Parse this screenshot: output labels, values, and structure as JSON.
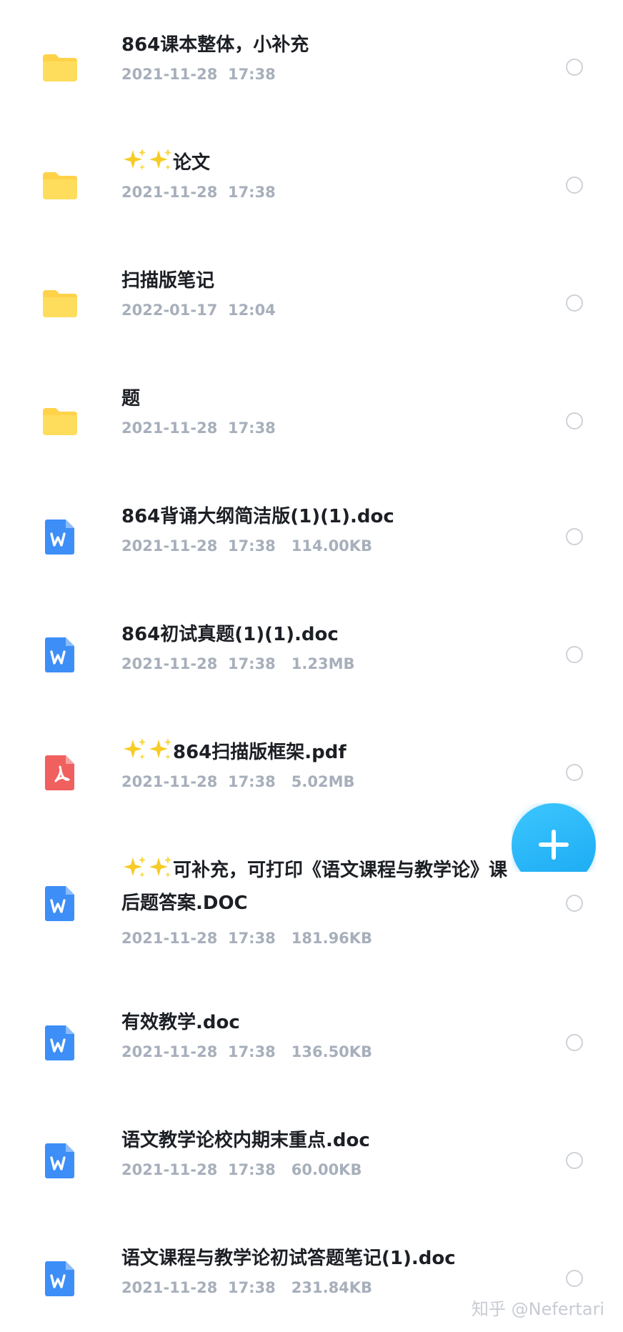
{
  "files": [
    {
      "type": "folder",
      "name": "864课本整体，小补充",
      "date": "2021-11-28",
      "time": "17:38",
      "size": ""
    },
    {
      "type": "folder",
      "name": "论文",
      "sparkles": true,
      "date": "2021-11-28",
      "time": "17:38",
      "size": ""
    },
    {
      "type": "folder",
      "name": "扫描版笔记",
      "date": "2022-01-17",
      "time": "12:04",
      "size": ""
    },
    {
      "type": "folder",
      "name": "题",
      "date": "2021-11-28",
      "time": "17:38",
      "size": ""
    },
    {
      "type": "word",
      "name": "864背诵大纲简洁版(1)(1).doc",
      "date": "2021-11-28",
      "time": "17:38",
      "size": "114.00KB"
    },
    {
      "type": "word",
      "name": "864初试真题(1)(1).doc",
      "date": "2021-11-28",
      "time": "17:38",
      "size": "1.23MB"
    },
    {
      "type": "pdf",
      "name": "864扫描版框架.pdf",
      "sparkles": true,
      "date": "2021-11-28",
      "time": "17:38",
      "size": "5.02MB"
    },
    {
      "type": "word",
      "name": "可补充，可打印《语文课程与教学论》课后题答案.DOC",
      "sparkles": true,
      "date": "2021-11-28",
      "time": "17:38",
      "size": "181.96KB"
    },
    {
      "type": "word",
      "name": "有效教学.doc",
      "date": "2021-11-28",
      "time": "17:38",
      "size": "136.50KB"
    },
    {
      "type": "word",
      "name": "语文教学论校内期末重点.doc",
      "date": "2021-11-28",
      "time": "17:38",
      "size": "60.00KB"
    },
    {
      "type": "word",
      "name": "语文课程与教学论初试答题笔记(1).doc",
      "date": "2021-11-28",
      "time": "17:38",
      "size": "231.84KB"
    }
  ],
  "fab": {
    "icon": "plus-icon"
  },
  "watermark": "知乎 @Nefertari",
  "colors": {
    "folder": "#ffd24a",
    "word": "#3d8ef7",
    "pdf": "#f0605f",
    "accent": "#22b3f5",
    "meta": "#a7afbb",
    "title": "#1c1f24"
  }
}
